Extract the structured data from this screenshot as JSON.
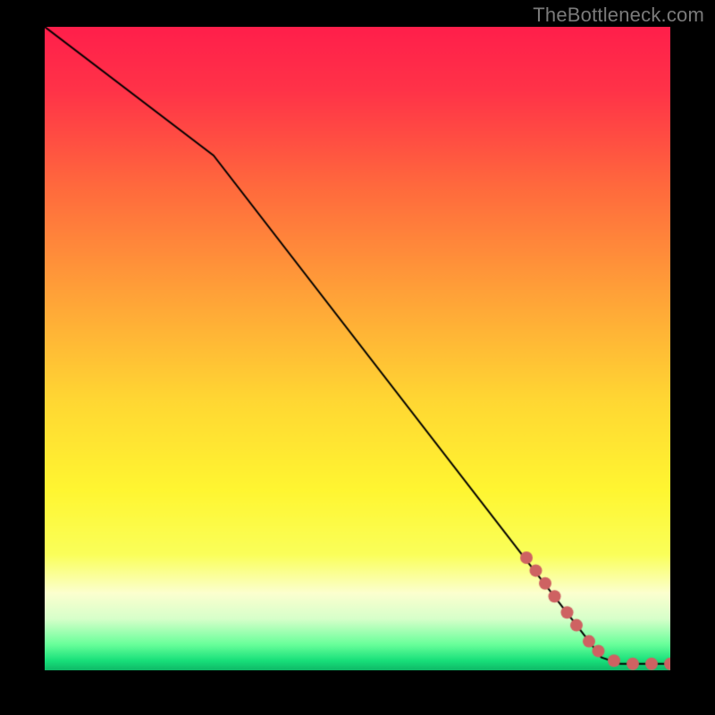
{
  "chart_data": {
    "type": "line",
    "attribution": "TheBottleneck.com",
    "xlim": [
      0,
      100
    ],
    "ylim": [
      0,
      100
    ],
    "xlabel": "",
    "ylabel": "",
    "title": "",
    "gradient_stops": [
      {
        "t": 0.0,
        "color": "#ff1f4b"
      },
      {
        "t": 0.1,
        "color": "#ff3348"
      },
      {
        "t": 0.25,
        "color": "#ff6a3d"
      },
      {
        "t": 0.42,
        "color": "#ffa338"
      },
      {
        "t": 0.58,
        "color": "#ffd733"
      },
      {
        "t": 0.72,
        "color": "#fff631"
      },
      {
        "t": 0.82,
        "color": "#faff5a"
      },
      {
        "t": 0.88,
        "color": "#fcffcf"
      },
      {
        "t": 0.92,
        "color": "#d7ffca"
      },
      {
        "t": 0.96,
        "color": "#68ff9a"
      },
      {
        "t": 0.985,
        "color": "#18e07a"
      },
      {
        "t": 1.0,
        "color": "#0fb867"
      }
    ],
    "curve": [
      {
        "x": 0,
        "y": 100
      },
      {
        "x": 27,
        "y": 80
      },
      {
        "x": 89,
        "y": 2
      },
      {
        "x": 92,
        "y": 1
      },
      {
        "x": 100,
        "y": 1
      }
    ],
    "points": [
      {
        "x": 77,
        "y": 17.5,
        "r": 7
      },
      {
        "x": 78.5,
        "y": 15.5,
        "r": 7
      },
      {
        "x": 80,
        "y": 13.5,
        "r": 7
      },
      {
        "x": 81.5,
        "y": 11.5,
        "r": 7
      },
      {
        "x": 83.5,
        "y": 9,
        "r": 7
      },
      {
        "x": 85,
        "y": 7,
        "r": 7
      },
      {
        "x": 87,
        "y": 4.5,
        "r": 7
      },
      {
        "x": 88.5,
        "y": 3,
        "r": 7
      },
      {
        "x": 91,
        "y": 1.5,
        "r": 7
      },
      {
        "x": 94,
        "y": 1,
        "r": 7
      },
      {
        "x": 97,
        "y": 1,
        "r": 7
      },
      {
        "x": 100,
        "y": 1,
        "r": 7
      }
    ],
    "point_color": "#ce6262",
    "line_color": "#000000",
    "line_width": 2
  }
}
